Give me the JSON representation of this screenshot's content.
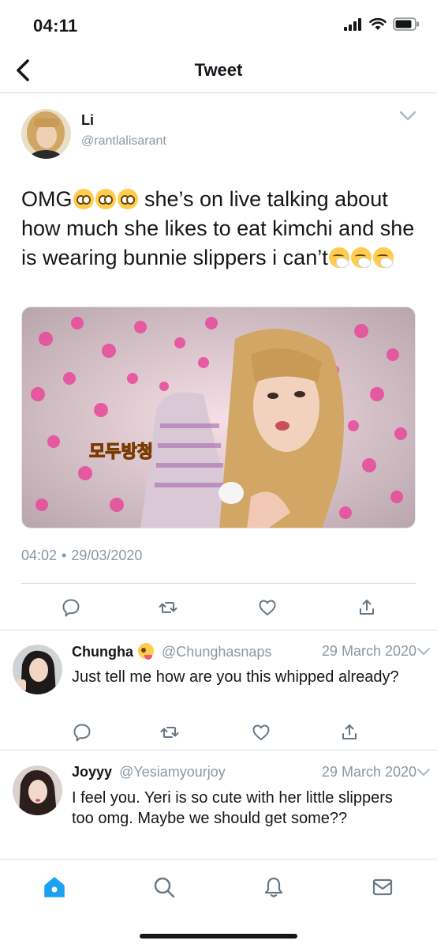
{
  "status_bar": {
    "time": "04:11",
    "icons": [
      "signal-icon",
      "wifi-icon",
      "battery-icon"
    ]
  },
  "header": {
    "title": "Tweet",
    "back_icon": "chevron-left-icon"
  },
  "tweet": {
    "author_name": "Li",
    "author_handle": "@rantlalisarant",
    "text_parts": {
      "p1": "OMG",
      "p2": " she’s on live talking about how much she likes to eat kimchi and she is wearing bunnie slippers i can’t"
    },
    "emojis": [
      "pleading-face",
      "pleading-face",
      "pleading-face",
      "sneezing-face",
      "sneezing-face",
      "sneezing-face"
    ],
    "time": "04:02",
    "separator": "•",
    "date": "29/03/2020",
    "actions": [
      "reply-icon",
      "retweet-icon",
      "like-icon",
      "share-icon"
    ]
  },
  "replies": [
    {
      "name": "Chungha",
      "name_emoji": "zany-face",
      "handle": "@Chunghasnaps",
      "date": "29 March 2020",
      "text": "Just tell me how are you this whipped already?"
    },
    {
      "name": "Joyyy",
      "handle": "@Yesiamyourjoy",
      "date": "29 March 2020",
      "text": "I feel you. Yeri is so cute with her little slippers too omg. Maybe we should get some??"
    }
  ],
  "tab_bar": {
    "tabs": [
      "home-icon",
      "search-icon",
      "notifications-icon",
      "messages-icon"
    ],
    "active": "home-icon"
  },
  "colors": {
    "accent": "#1da1f2",
    "text": "#14171a",
    "muted": "#8899a6",
    "divider": "#d8dde2"
  }
}
